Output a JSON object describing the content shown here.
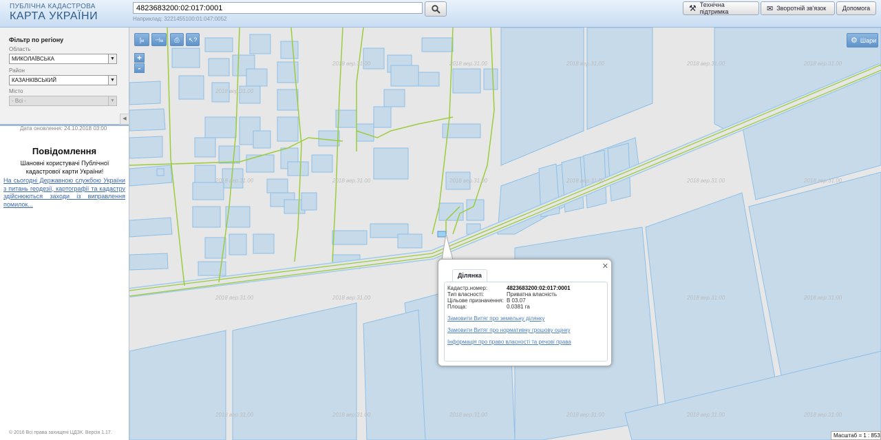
{
  "header": {
    "title_line1": "ПУБЛІЧНА КАДАСТРОВА",
    "title_line2": "КАРТА УКРАЇНИ",
    "search_value": "4823683200:02:017:0001",
    "search_example": "Наприклад: 3221455100:01:047:0052",
    "buttons": {
      "support": "Технічна підтримка",
      "feedback": "Зворотній зв'язок",
      "help": "Допомога"
    }
  },
  "filter": {
    "title": "Фільтр по регіону",
    "region_label": "Область",
    "region_value": "МИКОЛАЇВСЬКА",
    "district_label": "Район",
    "district_value": "КАЗАНКІВСЬКИЙ",
    "city_label": "Місто",
    "city_value": "- Всі -"
  },
  "sidebar": {
    "update_date": "Дата оновлення: 24.10.2018 03:00",
    "message_title": "Повідомлення",
    "message_text": "Шановні користувачі Публічної кадастрової карти України!",
    "message_link": "На сьогодні Державною службою України з питань геодезії, картографії та кадастру здійснюються заходи із виправлення помилок...",
    "copyright": "© 2016 Всі права захищені ЦДЗК. Версія 1.17."
  },
  "map": {
    "tools": [
      "м",
      "м"
    ],
    "zoom_in": "+",
    "zoom_out": "-",
    "layers_button": "Шари",
    "scale": "Масштаб = 1 : 8531",
    "watermark": "2018 вер.31.00",
    "colors": {
      "parcel_fill": "#c6daea",
      "parcel_stroke": "#8fbfe6",
      "boundary": "#9ccc3c",
      "background": "#e7e7e7"
    }
  },
  "popup": {
    "tab": "Ділянка",
    "fields": [
      {
        "label": "Кадастр.номер:",
        "value": "4823683200:02:017:0001"
      },
      {
        "label": "Тип власності:",
        "value": "Приватна власність"
      },
      {
        "label": "Цільове призначення:",
        "value": "В 03.07"
      },
      {
        "label": "Площа:",
        "value": "0.0381 га"
      }
    ],
    "links": [
      "Замовити Витяг про земельну ділянку",
      "Замовити Витяг про нормативну грошову оцінку",
      "Інформація про право власності та речові права"
    ]
  }
}
